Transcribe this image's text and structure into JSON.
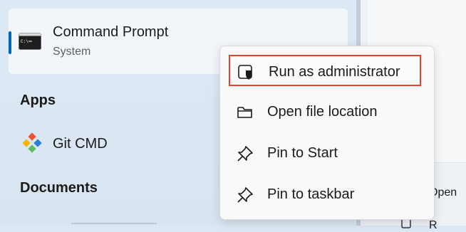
{
  "best_match": {
    "title": "Command Prompt",
    "subtitle": "System",
    "icon": "command-prompt-icon"
  },
  "sections": {
    "apps": "Apps",
    "documents": "Documents"
  },
  "apps": [
    {
      "label": "Git CMD",
      "icon": "git-icon"
    }
  ],
  "right_pane": {
    "open_label": "Open",
    "partial_label": "R"
  },
  "context_menu": {
    "items": [
      {
        "label": "Run as administrator",
        "icon": "shield-icon"
      },
      {
        "label": "Open file location",
        "icon": "folder-icon"
      },
      {
        "label": "Pin to Start",
        "icon": "pin-icon"
      },
      {
        "label": "Pin to taskbar",
        "icon": "pin-icon"
      }
    ]
  },
  "colors": {
    "accent": "#0067c0",
    "highlight_border": "#e0432f"
  }
}
